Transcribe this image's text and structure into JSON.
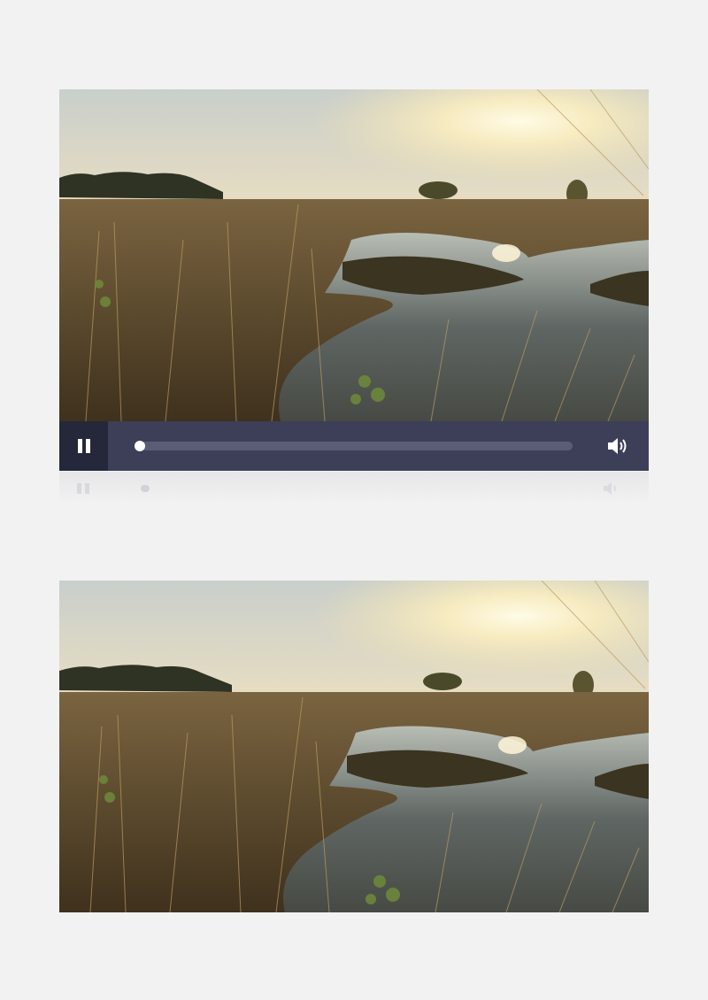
{
  "player": {
    "state": "playing",
    "progress_fraction": 0.0,
    "play_pause_icon": "pause-icon",
    "volume_icon": "volume-icon"
  },
  "scene": {
    "description_icon": "sunset-marsh-video-frame"
  },
  "colors": {
    "page_background": "#f2f2f2",
    "control_bar": "#3c3f57",
    "play_button_bg": "#25283b",
    "track": "#5a5d75",
    "knob": "#ffffff"
  }
}
